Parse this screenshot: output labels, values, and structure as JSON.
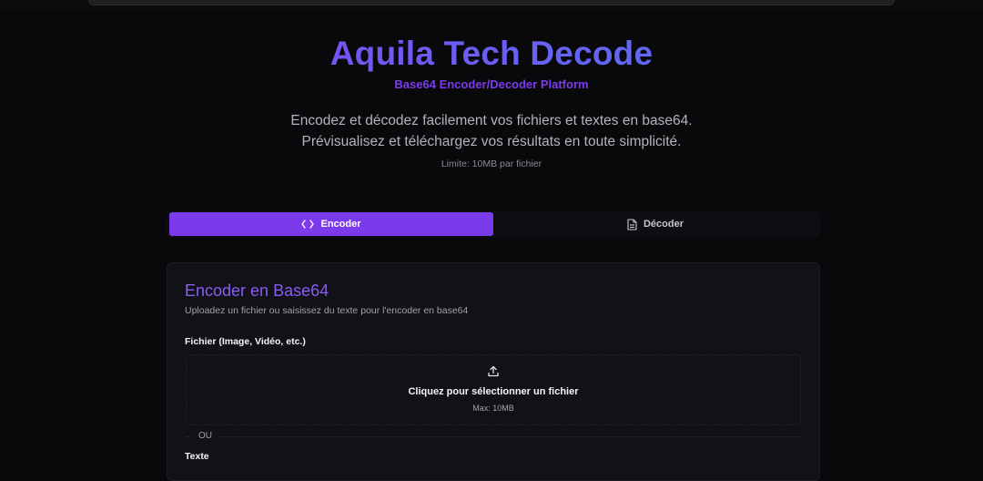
{
  "header": {
    "title": "Aquila Tech Decode",
    "subtitle": "Base64 Encoder/Decoder Platform",
    "description_line1": "Encodez et décodez facilement vos fichiers et textes en base64.",
    "description_line2": "Prévisualisez et téléchargez vos résultats en toute simplicité.",
    "limit": "Limite: 10MB par fichier"
  },
  "tabs": [
    {
      "label": "Encoder",
      "icon": "code-icon",
      "active": true
    },
    {
      "label": "Décoder",
      "icon": "file-text-icon",
      "active": false
    }
  ],
  "encode_card": {
    "title": "Encoder en Base64",
    "subtitle": "Uploadez un fichier ou saisissez du texte pour l'encoder en base64",
    "file_label": "Fichier (Image, Vidéo, etc.)",
    "dropzone_text": "Cliquez pour sélectionner un fichier",
    "dropzone_max": "Max: 10MB",
    "dropzone_icon": "upload-icon",
    "separator": "OU",
    "text_label": "Texte"
  },
  "colors": {
    "accent": "#7c3aed",
    "title_gradient_start": "#8b3cf0",
    "title_gradient_end": "#4a7cf2",
    "background": "#09090b",
    "card": "#111217"
  }
}
